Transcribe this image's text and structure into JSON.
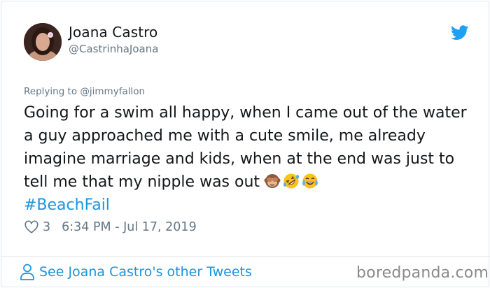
{
  "tweet": {
    "author_name": "Joana Castro",
    "author_handle": "@CastrinhaJoana",
    "reply_prefix": "Replying to ",
    "reply_to": "@jimmyfallon",
    "text": "Going for a swim all happy, when I came out of the water a guy approached  me with a cute smile, me already imagine marriage and kids, when at the end was just to tell me that my nipple  was out",
    "emojis": [
      "see-no-evil-monkey-icon",
      "rolling-on-floor-laughing-icon",
      "face-with-tears-of-joy-icon"
    ],
    "hashtag": "#BeachFail",
    "like_count": "3",
    "timestamp": "6:34 PM - Jul 17, 2019",
    "see_more": "See Joana Castro's other Tweets"
  },
  "watermark": "boredpanda.com",
  "colors": {
    "link": "#1b95e0",
    "secondary_text": "#657786",
    "twitter_blue": "#1da1f2",
    "border": "#e1e8ed"
  }
}
